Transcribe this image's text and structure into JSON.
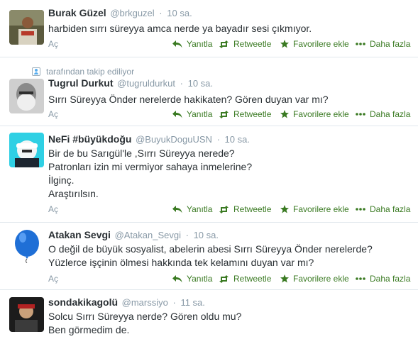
{
  "actions": {
    "expand": "Aç",
    "reply": "Yanıtla",
    "retweet": "Retweetle",
    "favorite": "Favorilere ekle",
    "more": "Daha fazla"
  },
  "colors": {
    "action_green": "#3a7a22",
    "muted": "#8899a6",
    "text": "#292f33",
    "divider": "#e1e8ed"
  },
  "tweets": [
    {
      "name": "Burak Güzel",
      "handle": "@brkguzel",
      "time": "10 sa.",
      "lines": [
        "harbiden sırrı süreyya amca nerde ya bayadır sesi çıkmıyor."
      ]
    },
    {
      "context": "tarafından takip ediliyor",
      "name": "Tugrul Durkut",
      "handle": "@tugruldurkut",
      "time": "10 sa.",
      "lines": [
        "Sırrı Süreyya Önder nerelerde hakikaten? Gören duyan var mı?"
      ]
    },
    {
      "name": "NeFi #büyükdoğu",
      "handle": "@BuyukDoguUSN",
      "time": "10 sa.",
      "lines": [
        "Bir de bu Sarıgül'le ,Sırrı Süreyya nerede?",
        "Patronları izin mi vermiyor sahaya inmelerine?",
        "İlginç.",
        "Araştırılsın."
      ]
    },
    {
      "name": "Atakan Sevgi",
      "handle": "@Atakan_Sevgi",
      "time": "10 sa.",
      "lines": [
        "O değil de büyük sosyalist, abelerin abesi Sırrı Süreyya Önder nerelerde?",
        "Yüzlerce işçinin ölmesi hakkında tek kelamını duyan var mı?"
      ]
    },
    {
      "name": "sondakikagolü",
      "handle": "@marssiyo",
      "time": "11 sa.",
      "lines": [
        "Solcu Sırrı Süreyya nerde? Gören oldu mu?",
        "Ben görmedim de."
      ]
    }
  ]
}
